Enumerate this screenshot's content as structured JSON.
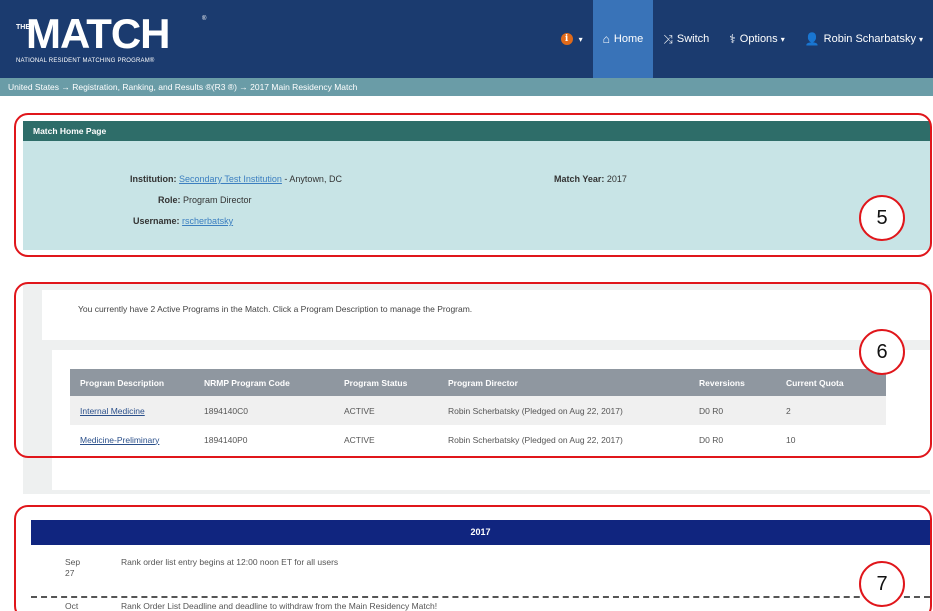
{
  "brand": {
    "the": "THE",
    "name": "MATCH",
    "trademark": "®",
    "subtitle": "NATIONAL RESIDENT MATCHING PROGRAM®"
  },
  "nav": {
    "info_icon": "info-icon",
    "home": "Home",
    "switch": "Switch",
    "options": "Options",
    "user": "Robin Scharbatsky"
  },
  "breadcrumb": "United States  →  Registration, Ranking, and Results ®(R3 ®)  →  2017 Main Residency Match",
  "match_home": {
    "title": "Match Home Page",
    "institution_label": "Institution:",
    "institution_value": "Secondary Test Institution",
    "institution_location": " - Anytown, DC",
    "role_label": "Role:",
    "role_value": "Program Director",
    "username_label": "Username:",
    "username_value": "rscherbatsky",
    "match_year_label": "Match Year:",
    "match_year_value": "2017"
  },
  "programs": {
    "summary": "You currently have 2 Active Programs in the Match. Click a Program Description to manage the Program.",
    "columns": [
      "Program Description",
      "NRMP Program Code",
      "Program Status",
      "Program Director",
      "Reversions",
      "Current Quota"
    ],
    "rows": [
      [
        "Internal Medicine",
        "1894140C0",
        "ACTIVE",
        "Robin Scherbatsky (Pledged on Aug 22, 2017)",
        "D0 R0",
        "2"
      ],
      [
        "Medicine-Preliminary",
        "1894140P0",
        "ACTIVE",
        "Robin Scherbatsky (Pledged on Aug 22, 2017)",
        "D0 R0",
        "10"
      ]
    ]
  },
  "calendar": {
    "year": "2017",
    "events": [
      {
        "month": "Sep",
        "day": "27",
        "text": "Rank order list entry begins at 12:00 noon ET for all users"
      },
      {
        "month": "Oct",
        "day": "",
        "text": "Rank Order List Deadline and deadline to withdraw from the Main Residency Match!"
      }
    ]
  },
  "annotations": [
    "5",
    "6",
    "7"
  ],
  "colors": {
    "header": "#1b3b6f",
    "active_tab": "#3973b8",
    "breadcrumb": "#6a9ca7",
    "panel_head": "#2e6d69",
    "panel_body": "#c8e4e6",
    "table_head": "#8f97a0",
    "calendar_bar": "#10257f",
    "annotation": "#e0161b"
  }
}
